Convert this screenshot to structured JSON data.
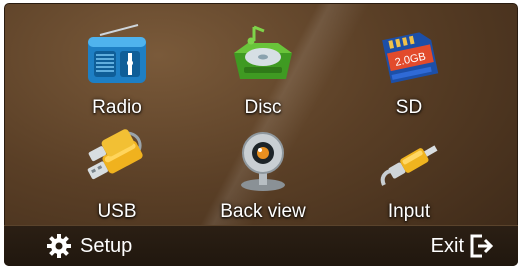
{
  "menu": {
    "tiles": [
      {
        "label": "Radio",
        "icon": "radio-icon"
      },
      {
        "label": "Disc",
        "icon": "disc-icon"
      },
      {
        "label": "SD",
        "icon": "sd-card-icon"
      },
      {
        "label": "USB",
        "icon": "usb-icon"
      },
      {
        "label": "Back view",
        "icon": "camera-icon"
      },
      {
        "label": "Input",
        "icon": "cable-plug-icon"
      }
    ]
  },
  "bottom_bar": {
    "setup_label": "Setup",
    "setup_icon": "gear-icon",
    "exit_label": "Exit",
    "exit_icon": "exit-icon"
  },
  "colors": {
    "background": "#5a3f26",
    "bar": "#241a10",
    "text": "#ffffff"
  }
}
